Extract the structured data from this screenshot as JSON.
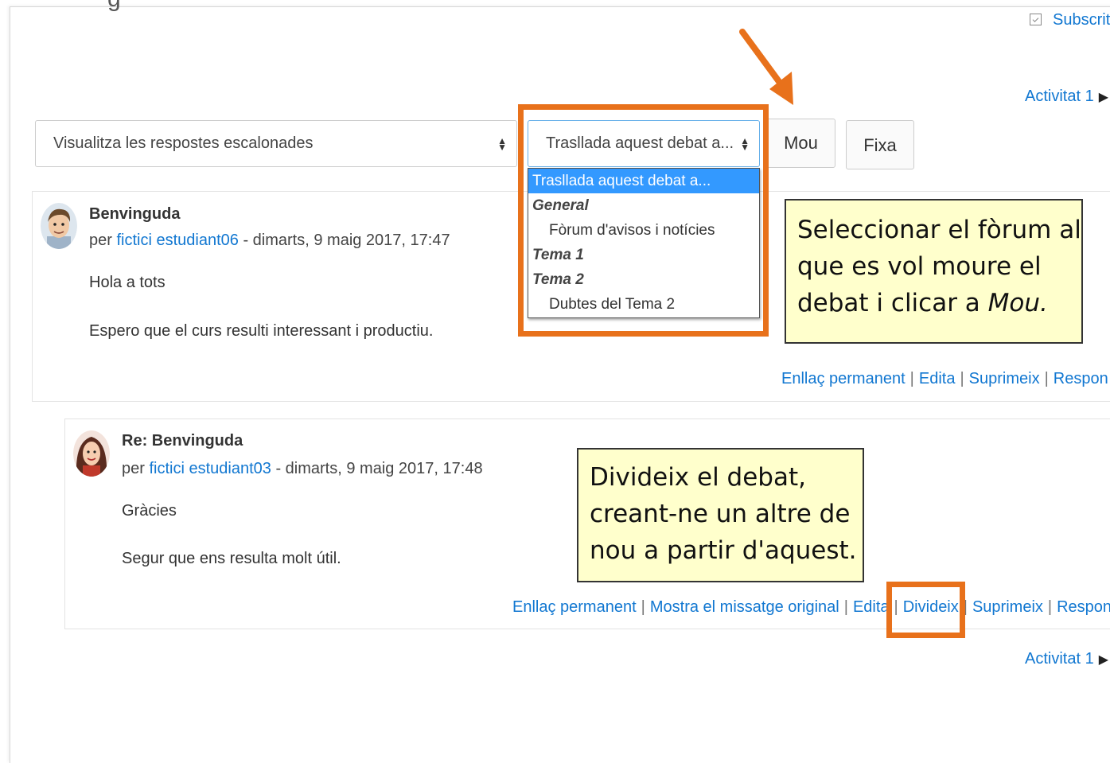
{
  "header": {
    "title_fragment": "g",
    "subscribe_label": "Subscrit",
    "next_activity_top": "Activitat 1",
    "next_activity_bottom": "Activitat 1"
  },
  "toolbar": {
    "display_mode_selected": "Visualitza les respostes escalonades",
    "move_select_selected": "Trasllada aquest debat a...",
    "move_button": "Mou",
    "pin_button": "Fixa"
  },
  "move_dropdown": {
    "options": [
      {
        "label": "Trasllada aquest debat a...",
        "type": "selected"
      },
      {
        "label": "General",
        "type": "group"
      },
      {
        "label": "Fòrum d'avisos i notícies",
        "type": "option"
      },
      {
        "label": "Tema 1",
        "type": "group"
      },
      {
        "label": "Tema 2",
        "type": "group"
      },
      {
        "label": "Dubtes del Tema 2",
        "type": "option"
      }
    ]
  },
  "posts": [
    {
      "subject": "Benvinguda",
      "by_prefix": "per",
      "author": "fictici estudiant06",
      "date": "- dimarts, 9 maig 2017, 17:47",
      "paragraphs": [
        "Hola a tots",
        "Espero que el curs resulti interessant i productiu."
      ],
      "commands": [
        "Enllaç permanent",
        "Edita",
        "Suprimeix",
        "Respon"
      ]
    },
    {
      "subject": "Re: Benvinguda",
      "by_prefix": "per",
      "author": "fictici estudiant03",
      "date": "- dimarts, 9 maig 2017, 17:48",
      "paragraphs": [
        "Gràcies",
        "Segur que ens resulta molt útil."
      ],
      "commands": [
        "Enllaç permanent",
        "Mostra el missatge original",
        "Edita",
        "Divideix",
        "Suprimeix",
        "Respon"
      ]
    }
  ],
  "annotations": {
    "move_note_lines": [
      "Seleccionar el fòrum al",
      "que es vol moure el",
      "debat i clicar a"
    ],
    "move_note_emphasis": "Mou.",
    "split_note_lines": [
      "Divideix el debat,",
      "creant-ne un altre de",
      "nou a partir d'aquest."
    ]
  },
  "colors": {
    "highlight": "#e8711b",
    "link": "#1177d1",
    "note_background": "#ffffcc",
    "selected_option": "#3399ff"
  }
}
